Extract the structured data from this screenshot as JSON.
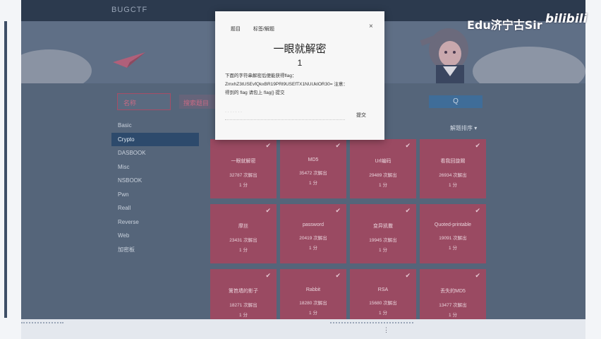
{
  "navbar": {
    "brand": "BUGCTF"
  },
  "search": {
    "placeholder": "名称",
    "keyword_label": "搜索题目",
    "button_label": "Q"
  },
  "categories": [
    {
      "label": "Basic"
    },
    {
      "label": "Crypto"
    },
    {
      "label": "DASBOOK"
    },
    {
      "label": "Misc"
    },
    {
      "label": "NSBOOK"
    },
    {
      "label": "Pwn"
    },
    {
      "label": "Reall"
    },
    {
      "label": "Reverse"
    },
    {
      "label": "Web"
    },
    {
      "label": "加密板"
    }
  ],
  "sort_label": "解题排序 ▾",
  "challenges": [
    {
      "name": "一眼就解密",
      "solves": "32787 次解出",
      "score": "1 分"
    },
    {
      "name": "MD5",
      "solves": "35472 次解出",
      "score": "1 分"
    },
    {
      "name": "Url编码",
      "solves": "29489 次解出",
      "score": "1 分"
    },
    {
      "name": "看我回旋踢",
      "solves": "26934 次解出",
      "score": "1 分"
    },
    {
      "name": "摩丝",
      "solves": "23431 次解出",
      "score": "1 分"
    },
    {
      "name": "password",
      "solves": "20419 次解出",
      "score": "1 分"
    },
    {
      "name": "变异凯撒",
      "solves": "19945 次解出",
      "score": "1 分"
    },
    {
      "name": "Quoted-printable",
      "solves": "19091 次解出",
      "score": "1 分"
    },
    {
      "name": "篱笆墙的影子",
      "solves": "18271 次解出",
      "score": "1 分"
    },
    {
      "name": "Rabbit",
      "solves": "18280 次解出",
      "score": "1 分"
    },
    {
      "name": "RSA",
      "solves": "15680 次解出",
      "score": "1 分"
    },
    {
      "name": "丢失的MD5",
      "solves": "13477 次解出",
      "score": "1 分"
    }
  ],
  "modal": {
    "tab1": "题目",
    "tab2": "标签/解题",
    "close": "×",
    "title": "一眼就解密",
    "score": "1",
    "desc_line1": "下面的字符串解密后便能获得flag：",
    "desc_line2": "ZmxhZ3tUSEvfQkxBR19PRl9USEfTX1NUUklOR30=  注意：",
    "desc_line3": "得到的 flag 请包上 flag{} 提交",
    "input_placeholder": "· · · · · · ·",
    "submit": "提交"
  },
  "watermark": {
    "text": "Edu济宁古Sir",
    "logo": "bilibili"
  },
  "colors": {
    "card": "#9a4a62",
    "active_cat": "#2d4a6c",
    "navbar": "#2c3a4e"
  },
  "icons": [
    "close-icon",
    "check-icon",
    "search-icon"
  ]
}
